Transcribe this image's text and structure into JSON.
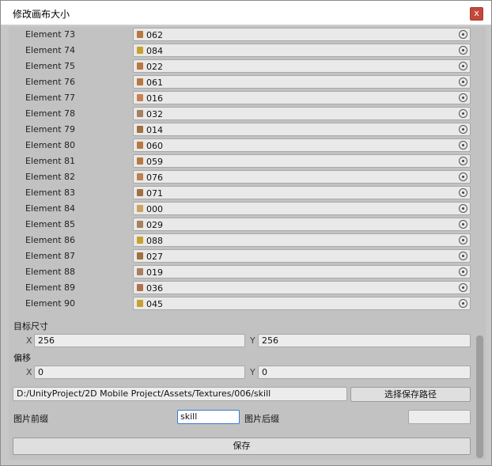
{
  "window": {
    "title": "修改画布大小",
    "close_label": "x"
  },
  "elements": [
    {
      "label": "Element 73",
      "value": "062",
      "icon_color": "#b87840"
    },
    {
      "label": "Element 74",
      "value": "084",
      "icon_color": "#c9a030"
    },
    {
      "label": "Element 75",
      "value": "022",
      "icon_color": "#b87840"
    },
    {
      "label": "Element 76",
      "value": "061",
      "icon_color": "#b87840"
    },
    {
      "label": "Element 77",
      "value": "016",
      "icon_color": "#c98050"
    },
    {
      "label": "Element 78",
      "value": "032",
      "icon_color": "#a88060"
    },
    {
      "label": "Element 79",
      "value": "014",
      "icon_color": "#a07040"
    },
    {
      "label": "Element 80",
      "value": "060",
      "icon_color": "#b87840"
    },
    {
      "label": "Element 81",
      "value": "059",
      "icon_color": "#b87840"
    },
    {
      "label": "Element 82",
      "value": "076",
      "icon_color": "#c08050"
    },
    {
      "label": "Element 83",
      "value": "071",
      "icon_color": "#a07040"
    },
    {
      "label": "Element 84",
      "value": "000",
      "icon_color": "#d0a060"
    },
    {
      "label": "Element 85",
      "value": "029",
      "icon_color": "#a88060"
    },
    {
      "label": "Element 86",
      "value": "088",
      "icon_color": "#c9a030"
    },
    {
      "label": "Element 87",
      "value": "027",
      "icon_color": "#a07040"
    },
    {
      "label": "Element 88",
      "value": "019",
      "icon_color": "#a88060"
    },
    {
      "label": "Element 89",
      "value": "036",
      "icon_color": "#b07050"
    },
    {
      "label": "Element 90",
      "value": "045",
      "icon_color": "#c9a030"
    }
  ],
  "target_size": {
    "label": "目标尺寸",
    "x_label": "X",
    "x_value": "256",
    "y_label": "Y",
    "y_value": "256"
  },
  "offset": {
    "label": "偏移",
    "x_label": "X",
    "x_value": "0",
    "y_label": "Y",
    "y_value": "0"
  },
  "path": {
    "value": "D:/UnityProject/2D Mobile Project/Assets/Textures/006/skill",
    "select_button": "选择保存路径"
  },
  "prefix": {
    "label": "图片前缀",
    "value": "skill"
  },
  "suffix": {
    "label": "图片后缀",
    "value": ""
  },
  "save_button": "保存"
}
